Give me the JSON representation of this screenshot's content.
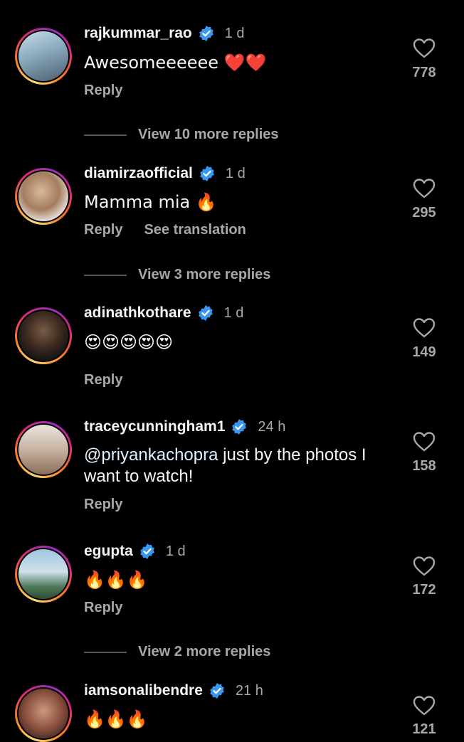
{
  "comments": [
    {
      "username": "rajkummar_rao",
      "time": "1 d",
      "text": "Awesomeeeeee ❤️❤️",
      "reply": "Reply",
      "likes": "778",
      "replies": "View 10 more replies"
    },
    {
      "username": "diamirzaofficial",
      "time": "1 d",
      "text": "Mamma mia 🔥",
      "reply": "Reply",
      "translate": "See translation",
      "likes": "295",
      "replies": "View 3 more replies"
    },
    {
      "username": "adinathkothare",
      "time": "1 d",
      "text": "😍😍😍😍😍",
      "reply": "Reply",
      "likes": "149"
    },
    {
      "username": "traceycunningham1",
      "time": "24 h",
      "mention": "@priyankachopra",
      "text": " just by the photos I want to watch!",
      "reply": "Reply",
      "likes": "158"
    },
    {
      "username": "egupta",
      "time": "1 d",
      "text": "🔥🔥🔥",
      "reply": "Reply",
      "likes": "172",
      "replies": "View 2 more replies"
    },
    {
      "username": "iamsonalibendre",
      "time": "21 h",
      "text": "🔥🔥🔥",
      "likes": "121"
    }
  ],
  "colors": {
    "verified": "#3897f0",
    "secondary": "#a8a8a8",
    "text": "#f5f5f5"
  },
  "icons": {
    "verified": "verified-badge-icon",
    "like": "heart-outline-icon"
  }
}
